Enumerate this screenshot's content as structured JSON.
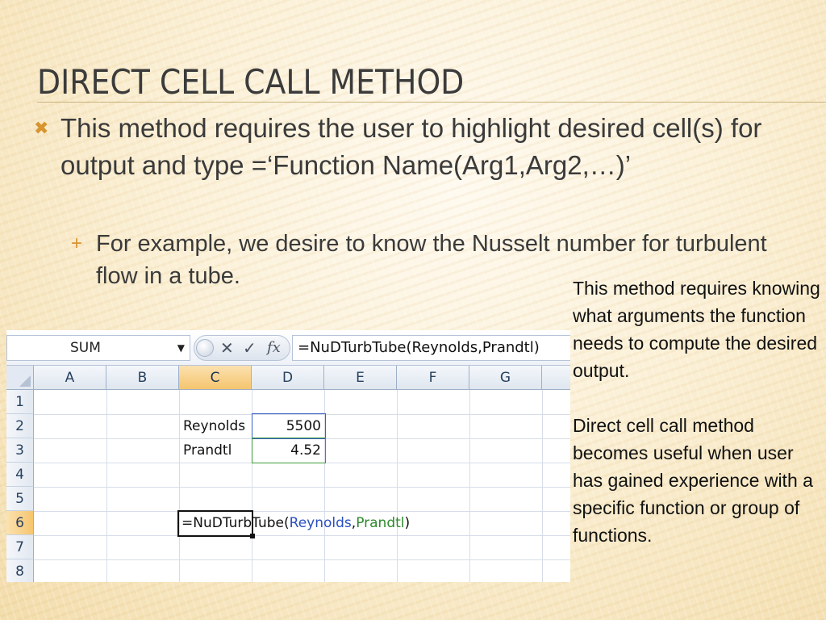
{
  "slide": {
    "title": "DIRECT CELL CALL METHOD",
    "bullet1": "This method requires the user to highlight desired cell(s) for output and type =‘Function Name(Arg1,Arg2,…)’",
    "bullet2": "For example, we desire to know the Nusselt number for turbulent flow in a tube.",
    "side_note": {
      "para1": "This method requires knowing what arguments the function needs to compute the desired output.",
      "para2": "Direct cell call method becomes useful when user has gained experience with a specific function or group of functions."
    }
  },
  "spreadsheet": {
    "name_box": "SUM",
    "formula": "=NuDTurbTube(Reynolds,Prandtl)",
    "buttons": {
      "cancel": "✕",
      "enter": "✓",
      "fx": "fx"
    },
    "columns": [
      "A",
      "B",
      "C",
      "D",
      "E",
      "F",
      "G"
    ],
    "rows": [
      "1",
      "2",
      "3",
      "4",
      "5",
      "6",
      "7",
      "8"
    ],
    "active_column": "C",
    "active_row": "6",
    "cells": {
      "C2": "Reynolds",
      "D2": "5500",
      "C3": "Prandtl",
      "D3": "4.52",
      "C6_prefix": "=NuDTurbTube(",
      "C6_arg1": "Reynolds",
      "C6_sep": ",",
      "C6_arg2": "Prandtl",
      "C6_suffix": ")"
    }
  },
  "colors": {
    "bullet_accent": "#d7942f",
    "ref_blue": "#2a4fc2",
    "ref_green": "#2b8a2b",
    "header_active": "#f5c56e"
  },
  "icons": {
    "bullet1": "x-mark-bullet-icon",
    "bullet2": "plus-bullet-icon"
  }
}
